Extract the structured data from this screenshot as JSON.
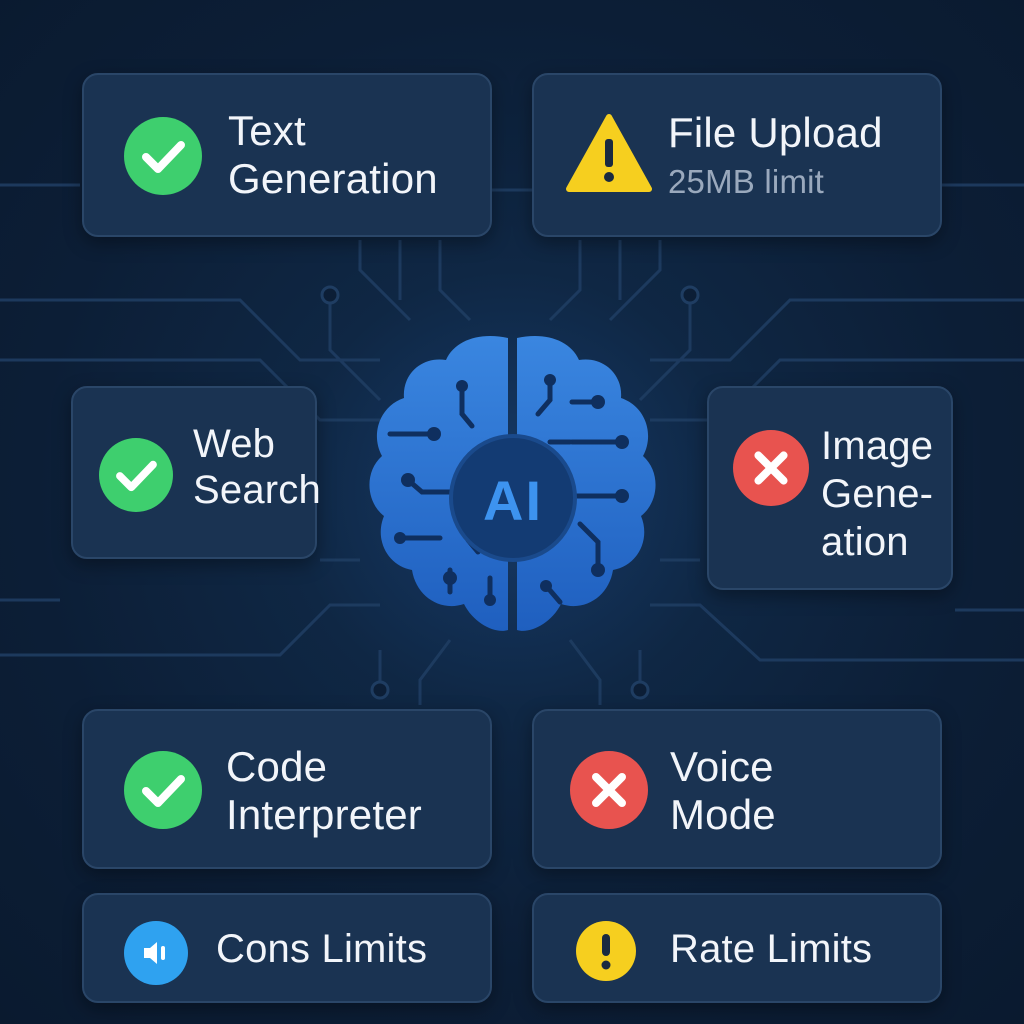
{
  "center": {
    "label": "AI"
  },
  "cards": {
    "text_generation": {
      "line1": "Text",
      "line2": "Generation",
      "status": "supported",
      "icon": "check-circle-icon"
    },
    "file_upload": {
      "title": "File Upload",
      "note": "25MB limit",
      "status": "warning",
      "icon": "warning-triangle-icon"
    },
    "web_search": {
      "line1": "Web",
      "line2": "Search",
      "status": "supported",
      "icon": "check-circle-icon"
    },
    "image_generation": {
      "line1": "Image",
      "line2": "Gene-",
      "line3": "ation",
      "status": "unsupported",
      "icon": "x-circle-icon"
    },
    "code_interpreter": {
      "line1": "Code",
      "line2": "Interpreter",
      "status": "supported",
      "icon": "check-circle-icon"
    },
    "voice_mode": {
      "line1": "Voice",
      "line2": "Mode",
      "status": "unsupported",
      "icon": "x-circle-icon"
    },
    "cons_limits": {
      "title": "Cons Limits",
      "icon": "speaker-circle-icon"
    },
    "rate_limits": {
      "title": "Rate Limits",
      "icon": "exclamation-circle-icon"
    }
  },
  "colors": {
    "background": "#0c1e36",
    "card": "#1a3352",
    "check_green": "#3ecf6e",
    "warning_yellow": "#f6cf1f",
    "error_red": "#e8534f",
    "info_blue": "#2fa2f0",
    "brain_blue": "#2a74d0"
  }
}
